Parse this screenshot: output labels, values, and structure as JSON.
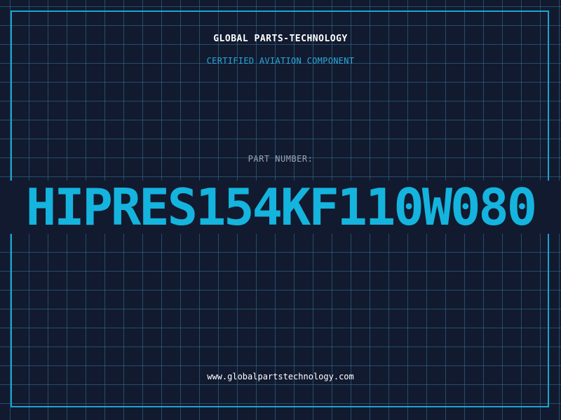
{
  "header": {
    "company": "GLOBAL PARTS-TECHNOLOGY",
    "subtitle": "CERTIFIED AVIATION COMPONENT"
  },
  "part": {
    "label": "PART NUMBER:",
    "number": "HIPRES154KF110W080"
  },
  "footer": {
    "website": "www.globalpartstechnology.com"
  },
  "colors": {
    "background": "#121a2f",
    "grid": "#347696",
    "frame": "#1aa5cf",
    "accent": "#14b4de",
    "label": "#9aa3b4",
    "text": "#ffffff"
  }
}
